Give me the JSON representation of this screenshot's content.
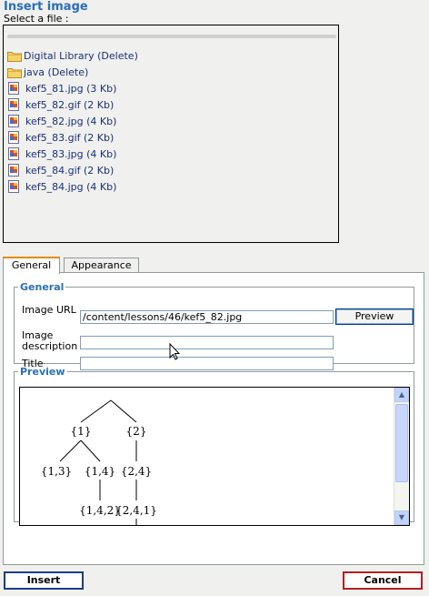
{
  "dialog": {
    "title": "Insert image",
    "select_label": "Select a file :"
  },
  "files": [
    {
      "type": "folder",
      "label": "Digital Library (Delete)"
    },
    {
      "type": "folder",
      "label": "java (Delete)"
    },
    {
      "type": "file",
      "label": "kef5_81.jpg (3 Kb)"
    },
    {
      "type": "file",
      "label": "kef5_82.gif (2 Kb)"
    },
    {
      "type": "file",
      "label": "kef5_82.jpg (4 Kb)"
    },
    {
      "type": "file",
      "label": "kef5_83.gif (2 Kb)"
    },
    {
      "type": "file",
      "label": "kef5_83.jpg (4 Kb)"
    },
    {
      "type": "file",
      "label": "kef5_84.gif (2 Kb)"
    },
    {
      "type": "file",
      "label": "kef5_84.jpg (4 Kb)"
    }
  ],
  "tabs": [
    {
      "label": "General",
      "active": true
    },
    {
      "label": "Appearance",
      "active": false
    }
  ],
  "general": {
    "legend": "General",
    "image_url_label": "Image URL",
    "image_url_value": "/content/lessons/46/kef5_82.jpg",
    "preview_button": "Preview",
    "description_label": "Image description",
    "description_value": "",
    "title_label": "Title",
    "title_value": ""
  },
  "preview": {
    "legend": "Preview",
    "tree_nodes": [
      "{1}",
      "{2}",
      "{1,3}",
      "{1,4}",
      "{2,4}",
      "{1,4,2}",
      "{2,4,1}"
    ]
  },
  "buttons": {
    "insert": "Insert",
    "cancel": "Cancel"
  },
  "colors": {
    "title": "#2b6fb6",
    "link": "#1c2f78",
    "insert_border": "#1c3c8a",
    "cancel_border": "#b02020"
  }
}
